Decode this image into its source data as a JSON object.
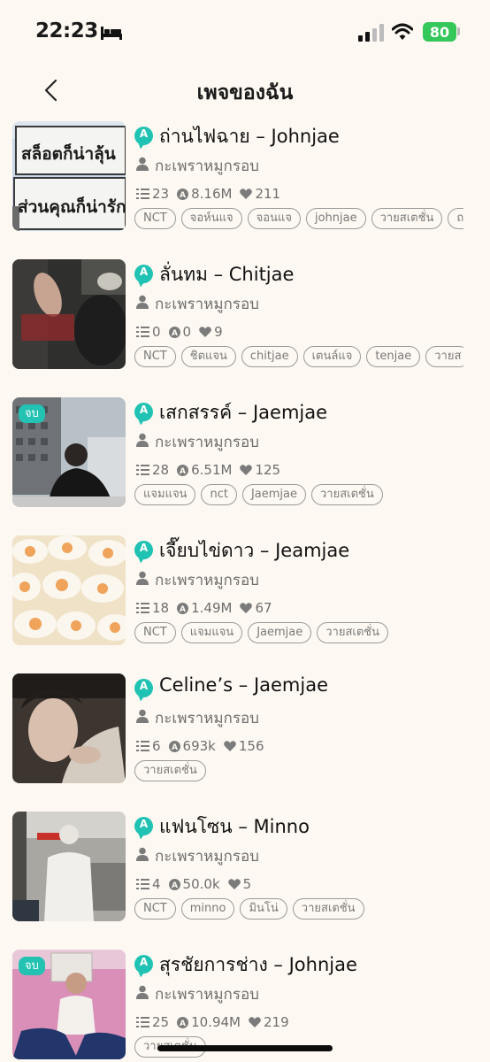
{
  "status_bar": {
    "time": "22:23",
    "battery": "80"
  },
  "header": {
    "title": "เพจของฉัน"
  },
  "colors": {
    "background": "#fdf9f2",
    "accent": "#20c2b4",
    "battery": "#34c759"
  },
  "stories": [
    {
      "title": "ถ่านไฟฉาย – Johnjae",
      "author": "กะเพราหมูกรอบ",
      "chapters": "23",
      "views": "8.16M",
      "likes": "211",
      "tags": [
        "NCT",
        "จอห์นแจ",
        "จอนแจ",
        "johnjae",
        "วายสเตชั่น",
        "ถ"
      ],
      "badge": "",
      "cover_text": [
        "สล็อตก็น่าลุ้น",
        "ส่วนคุณก็น่ารัก"
      ]
    },
    {
      "title": "ลั่นทม – Chitjae",
      "author": "กะเพราหมูกรอบ",
      "chapters": "0",
      "views": "0",
      "likes": "9",
      "tags": [
        "NCT",
        "ชิตแจน",
        "chitjae",
        "เตนล์แจ",
        "tenjae",
        "วายส"
      ],
      "badge": ""
    },
    {
      "title": "เสกสรรค์ – Jaemjae",
      "author": "กะเพราหมูกรอบ",
      "chapters": "28",
      "views": "6.51M",
      "likes": "125",
      "tags": [
        "แจมแจน",
        "nct",
        "Jaemjae",
        "วายสเตชั่น"
      ],
      "badge": "จบ"
    },
    {
      "title": "เจี๊ยบไข่ดาว – Jeamjae",
      "author": "กะเพราหมูกรอบ",
      "chapters": "18",
      "views": "1.49M",
      "likes": "67",
      "tags": [
        "NCT",
        "แจมแจน",
        "Jaemjae",
        "วายสเตชั่น"
      ],
      "badge": ""
    },
    {
      "title": "Celine’s – Jaemjae",
      "author": "กะเพราหมูกรอบ",
      "chapters": "6",
      "views": "693k",
      "likes": "156",
      "tags": [
        "วายสเตชั่น"
      ],
      "badge": ""
    },
    {
      "title": "แฟนโซน – Minno",
      "author": "กะเพราหมูกรอบ",
      "chapters": "4",
      "views": "50.0k",
      "likes": "5",
      "tags": [
        "NCT",
        "minno",
        "มินโน่",
        "วายสเตชั่น"
      ],
      "badge": ""
    },
    {
      "title": "สุรชัยการช่าง – Johnjae",
      "author": "กะเพราหมูกรอบ",
      "chapters": "25",
      "views": "10.94M",
      "likes": "219",
      "tags": [
        "วายสเตชั่น"
      ],
      "badge": "จบ"
    }
  ],
  "icons": {
    "back": "chevron-left-icon",
    "author": "person-icon",
    "chapters": "list-icon",
    "views": "a-circle-icon",
    "likes": "heart-icon",
    "status": [
      "bed-icon",
      "signal-icon",
      "wifi-icon",
      "battery-icon"
    ]
  }
}
